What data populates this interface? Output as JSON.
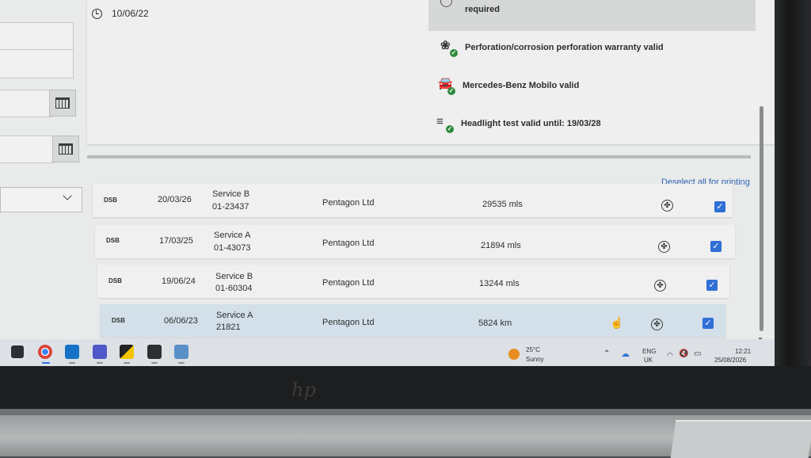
{
  "header": {
    "date": "10/06/22",
    "warning_text": "required",
    "statuses": [
      {
        "label": "Perforation/corrosion perforation warranty valid",
        "icon": "certificate-icon"
      },
      {
        "label": "Mercedes-Benz Mobilo valid",
        "icon": "car-icon"
      },
      {
        "label": "Headlight test valid until: 19/03/28",
        "icon": "headlight-icon"
      }
    ]
  },
  "history": {
    "deselect_label": "Deselect all for printing",
    "rows": [
      {
        "code": "DSB",
        "date": "20/03/26",
        "service": "Service B",
        "number": "01-23437",
        "partner": "Pentagon Ltd",
        "mileage": "29535 mls",
        "checked": true
      },
      {
        "code": "DSB",
        "date": "17/03/25",
        "service": "Service A",
        "number": "01-43073",
        "partner": "Pentagon Ltd",
        "mileage": "21894 mls",
        "checked": true
      },
      {
        "code": "DSB",
        "date": "19/06/24",
        "service": "Service B",
        "number": "01-60304",
        "partner": "Pentagon Ltd",
        "mileage": "13244 mls",
        "checked": true
      },
      {
        "code": "DSB",
        "date": "06/06/23",
        "service": "Service A",
        "number": "21821",
        "partner": "Pentagon Ltd",
        "mileage": "5824 km",
        "checked": true
      }
    ]
  },
  "taskbar": {
    "weather_temp": "25°C",
    "weather_desc": "Sunny",
    "lang_1": "ENG",
    "lang_2": "UK",
    "time": "12:21",
    "date": "25/08/2026"
  },
  "device": {
    "brand": "hp"
  },
  "colors": {
    "accent": "#2f6fd6",
    "link": "#2f62b5",
    "status_check": "#2f8a3f"
  }
}
